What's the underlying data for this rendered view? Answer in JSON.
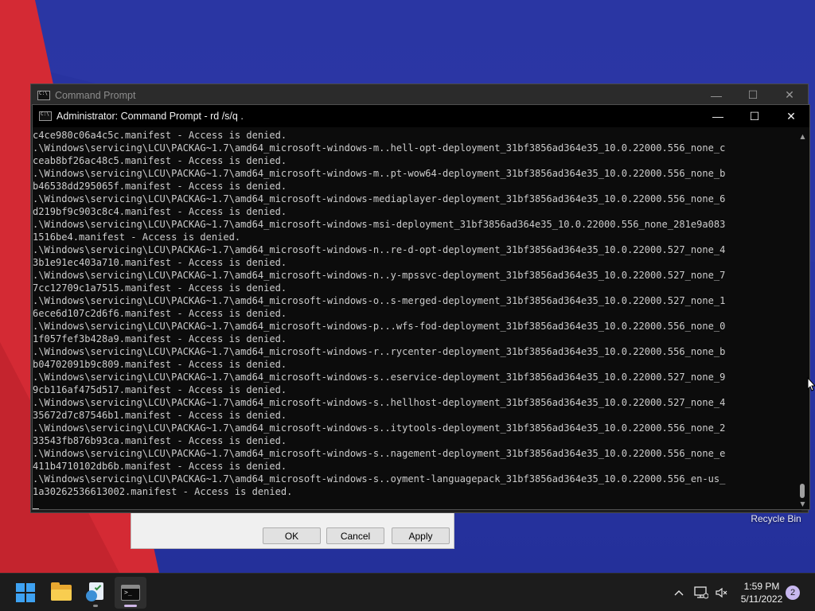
{
  "desktop": {
    "recycle_bin_label": "Recycle Bin"
  },
  "dialog": {
    "ok_label": "OK",
    "cancel_label": "Cancel",
    "apply_label": "Apply"
  },
  "back_window": {
    "title": "Command Prompt",
    "icon": "cmd-icon"
  },
  "front_window": {
    "title": "Administrator: Command Prompt - rd  /s/q .",
    "icon": "cmd-icon"
  },
  "caption_buttons": {
    "minimize": "—",
    "maximize": "☐",
    "close": "✕"
  },
  "console_lines": [
    "c4ce980c06a4c5c.manifest - Access is denied.",
    ".\\Windows\\servicing\\LCU\\PACKAG~1.7\\amd64_microsoft-windows-m..hell-opt-deployment_31bf3856ad364e35_10.0.22000.556_none_c",
    "ceab8bf26ac48c5.manifest - Access is denied.",
    ".\\Windows\\servicing\\LCU\\PACKAG~1.7\\amd64_microsoft-windows-m..pt-wow64-deployment_31bf3856ad364e35_10.0.22000.556_none_b",
    "b46538dd295065f.manifest - Access is denied.",
    ".\\Windows\\servicing\\LCU\\PACKAG~1.7\\amd64_microsoft-windows-mediaplayer-deployment_31bf3856ad364e35_10.0.22000.556_none_6",
    "d219bf9c903c8c4.manifest - Access is denied.",
    ".\\Windows\\servicing\\LCU\\PACKAG~1.7\\amd64_microsoft-windows-msi-deployment_31bf3856ad364e35_10.0.22000.556_none_281e9a083",
    "1516be4.manifest - Access is denied.",
    ".\\Windows\\servicing\\LCU\\PACKAG~1.7\\amd64_microsoft-windows-n..re-d-opt-deployment_31bf3856ad364e35_10.0.22000.527_none_4",
    "3b1e91ec403a710.manifest - Access is denied.",
    ".\\Windows\\servicing\\LCU\\PACKAG~1.7\\amd64_microsoft-windows-n..y-mpssvc-deployment_31bf3856ad364e35_10.0.22000.527_none_7",
    "7cc12709c1a7515.manifest - Access is denied.",
    ".\\Windows\\servicing\\LCU\\PACKAG~1.7\\amd64_microsoft-windows-o..s-merged-deployment_31bf3856ad364e35_10.0.22000.527_none_1",
    "6ece6d107c2d6f6.manifest - Access is denied.",
    ".\\Windows\\servicing\\LCU\\PACKAG~1.7\\amd64_microsoft-windows-p...wfs-fod-deployment_31bf3856ad364e35_10.0.22000.556_none_0",
    "1f057fef3b428a9.manifest - Access is denied.",
    ".\\Windows\\servicing\\LCU\\PACKAG~1.7\\amd64_microsoft-windows-r..rycenter-deployment_31bf3856ad364e35_10.0.22000.556_none_b",
    "b04702091b9c809.manifest - Access is denied.",
    ".\\Windows\\servicing\\LCU\\PACKAG~1.7\\amd64_microsoft-windows-s..eservice-deployment_31bf3856ad364e35_10.0.22000.527_none_9",
    "9cb116af475d517.manifest - Access is denied.",
    ".\\Windows\\servicing\\LCU\\PACKAG~1.7\\amd64_microsoft-windows-s..hellhost-deployment_31bf3856ad364e35_10.0.22000.527_none_4",
    "35672d7c87546b1.manifest - Access is denied.",
    ".\\Windows\\servicing\\LCU\\PACKAG~1.7\\amd64_microsoft-windows-s..itytools-deployment_31bf3856ad364e35_10.0.22000.556_none_2",
    "33543fb876b93ca.manifest - Access is denied.",
    ".\\Windows\\servicing\\LCU\\PACKAG~1.7\\amd64_microsoft-windows-s..nagement-deployment_31bf3856ad364e35_10.0.22000.556_none_e",
    "411b4710102db6b.manifest - Access is denied.",
    ".\\Windows\\servicing\\LCU\\PACKAG~1.7\\amd64_microsoft-windows-s..oyment-languagepack_31bf3856ad364e35_10.0.22000.556_en-us_",
    "1a30262536613002.manifest - Access is denied."
  ],
  "taskbar": {
    "apps": [
      {
        "name": "start",
        "icon": "windows-logo-icon"
      },
      {
        "name": "file-explorer",
        "icon": "folder-icon"
      },
      {
        "name": "security-app",
        "icon": "security-icon"
      },
      {
        "name": "command-prompt",
        "icon": "terminal-icon",
        "active": true
      }
    ],
    "tray": {
      "chevron": "^",
      "time": "1:59 PM",
      "date": "5/11/2022",
      "notification_count": "2"
    }
  },
  "colors": {
    "console_bg": "#0c0c0c",
    "console_fg": "#cccccc",
    "start_blue": "#3ea2f2",
    "wallpaper_blue": "#2a36a6",
    "wallpaper_red": "#d42a34"
  }
}
